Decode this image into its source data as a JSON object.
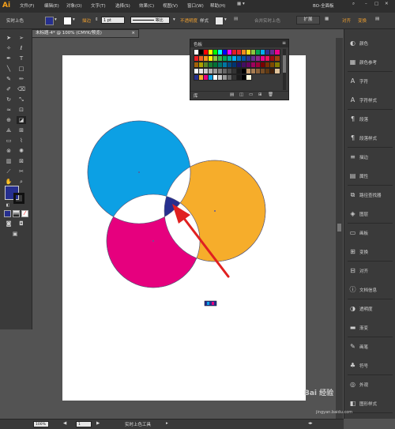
{
  "app": {
    "logo": "Ai",
    "menu": [
      "文件(F)",
      "编辑(E)",
      "对象(O)",
      "文字(T)",
      "选择(S)",
      "效果(C)",
      "视图(V)",
      "窗口(W)",
      "帮助(H)"
    ],
    "workspace": "BO-全面板"
  },
  "control_bar": {
    "selection_label": "实时上色",
    "stroke_label": "描边",
    "stroke_weight": "1 pt",
    "stroke_profile": "等比",
    "opacity_label": "不透明度",
    "style_label": "样式",
    "merge_label": "合并实时上色",
    "expand_label": "扩展",
    "align_label": "对齐",
    "transform_label": "变换"
  },
  "document": {
    "tab_title": "未标题-4* @ 100% (CMYK/预览)",
    "close": "×"
  },
  "swatch_panel": {
    "title": "色板",
    "footer_icon": "库",
    "rows": [
      [
        "#ffffff",
        "#000000",
        "#ff0000",
        "#ffff00",
        "#00ff00",
        "#00ffff",
        "#0000ff",
        "#ff00ff",
        "#e31c23",
        "#e7262a",
        "#f18c1f",
        "#ffde17",
        "#8dc63f",
        "#00a651",
        "#00aeef",
        "#2e3192",
        "#662d91",
        "#ec008c"
      ],
      [
        "#ed1c24",
        "#f26522",
        "#f7941d",
        "#fff200",
        "#8dc63f",
        "#39b54a",
        "#00a651",
        "#00a99d",
        "#00aeef",
        "#0072bc",
        "#0054a6",
        "#2e3192",
        "#662d91",
        "#92278f",
        "#ec008c",
        "#ed145b",
        "#9e0b0f",
        "#a0410d"
      ],
      [
        "#a3620a",
        "#aba000",
        "#598527",
        "#197b30",
        "#007236",
        "#00746b",
        "#0076a3",
        "#004a80",
        "#003471",
        "#1b1464",
        "#440e62",
        "#630460",
        "#9e005d",
        "#9e0039",
        "#790000",
        "#7b2e00",
        "#7d4900",
        "#827b00"
      ],
      [
        "#ffffff",
        "#e6e6e6",
        "#cccccc",
        "#b3b3b3",
        "#999999",
        "#808080",
        "#666666",
        "#4d4d4d",
        "#333333",
        "#1a1a1a",
        "#000000",
        "#c69c6d",
        "#a67c52",
        "#8c6239",
        "#754c24",
        "#603913",
        "#42210b",
        "#e0c39b"
      ],
      [
        "#262f8f",
        "#f6ad2b",
        "#e6007e",
        "#0ca0e4",
        "#ffffff",
        "#cccccc",
        "#999999",
        "#666666",
        "#333333",
        "#1a1a1a",
        "#000000",
        "#fffde0"
      ]
    ]
  },
  "right_panel": {
    "items": [
      {
        "label": "颜色",
        "icon": "color-icon",
        "glyph": "◐"
      },
      {
        "label": "颜色参考",
        "icon": "color-guide-icon",
        "glyph": "▦"
      },
      {
        "label": "字符",
        "icon": "character-icon",
        "glyph": "A"
      },
      {
        "label": "字符样式",
        "icon": "character-style-icon",
        "glyph": "A"
      },
      {
        "label": "段落",
        "icon": "paragraph-icon",
        "glyph": "¶"
      },
      {
        "label": "段落样式",
        "icon": "paragraph-style-icon",
        "glyph": "¶"
      },
      {
        "label": "描边",
        "icon": "stroke-icon",
        "glyph": "≡"
      },
      {
        "label": "属性",
        "icon": "attributes-icon",
        "glyph": "▤"
      },
      {
        "label": "路径查找器",
        "icon": "pathfinder-icon",
        "glyph": "⧉"
      },
      {
        "label": "图层",
        "icon": "layers-icon",
        "glyph": "◈"
      },
      {
        "label": "画板",
        "icon": "artboards-icon",
        "glyph": "▭"
      },
      {
        "label": "变换",
        "icon": "transform-icon",
        "glyph": "⊞"
      },
      {
        "label": "对齐",
        "icon": "align-icon",
        "glyph": "⊟"
      },
      {
        "label": "文档信息",
        "icon": "document-info-icon",
        "glyph": "ⓘ"
      },
      {
        "label": "透明度",
        "icon": "transparency-icon",
        "glyph": "◑"
      },
      {
        "label": "渐变",
        "icon": "gradient-icon",
        "glyph": "▬"
      },
      {
        "label": "画笔",
        "icon": "brushes-icon",
        "glyph": "✎"
      },
      {
        "label": "符号",
        "icon": "symbols-icon",
        "glyph": "♣"
      },
      {
        "label": "外观",
        "icon": "appearance-icon",
        "glyph": "◎"
      },
      {
        "label": "图形样式",
        "icon": "graphic-styles-icon",
        "glyph": "◧"
      }
    ]
  },
  "status_bar": {
    "zoom": "100%",
    "page": "1",
    "tool_name": "实时上色工具"
  },
  "colors": {
    "cyan": "#0ca0e4",
    "yellow": "#f6ad2b",
    "magenta": "#e6007e",
    "navy": "#262f8f",
    "arrow": "#e02020",
    "fill_swatch": "#262f8f"
  },
  "watermark": {
    "text": "Bai 经验",
    "url": "jingyan.baidu.com"
  }
}
